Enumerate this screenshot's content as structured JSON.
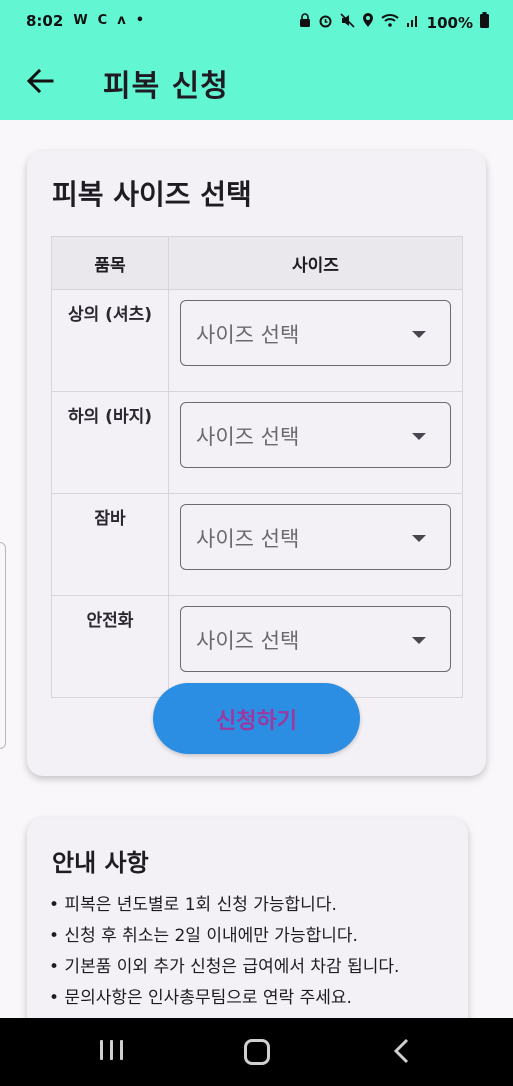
{
  "status_bar": {
    "time": "8:02",
    "left_icons": [
      "W",
      "C",
      "ʌ",
      "•"
    ],
    "battery": "100%",
    "right_icons": [
      "lock-icon",
      "alarm-icon",
      "mute-icon",
      "location-icon",
      "wifi-icon",
      "signal-icon",
      "battery-icon"
    ]
  },
  "app_bar": {
    "back_icon": "arrow-left-icon",
    "title": "피복 신청",
    "background": "#62f7d2"
  },
  "size_card": {
    "title": "피복 사이즈 선택",
    "columns": [
      "품목",
      "사이즈"
    ],
    "rows": [
      {
        "item": "상의 (셔츠)",
        "select_placeholder": "사이즈 선택"
      },
      {
        "item": "하의 (바지)",
        "select_placeholder": "사이즈 선택"
      },
      {
        "item": "잠바",
        "select_placeholder": "사이즈 선택"
      },
      {
        "item": "안전화",
        "select_placeholder": "사이즈 선택"
      }
    ],
    "submit_label": "신청하기",
    "submit_color": "#2b8ee3"
  },
  "notice_card": {
    "title": "안내 사항",
    "items": [
      "• 피복은 년도별로 1회 신청 가능합니다.",
      "• 신청 후 취소는 2일 이내에만 가능합니다.",
      "• 기본품 이외 추가 신청은 급여에서 차감 됩니다.",
      "• 문의사항은 인사총무팀으로 연락 주세요."
    ]
  },
  "nav_bar": {
    "buttons": [
      "recent-apps",
      "home",
      "back"
    ]
  }
}
